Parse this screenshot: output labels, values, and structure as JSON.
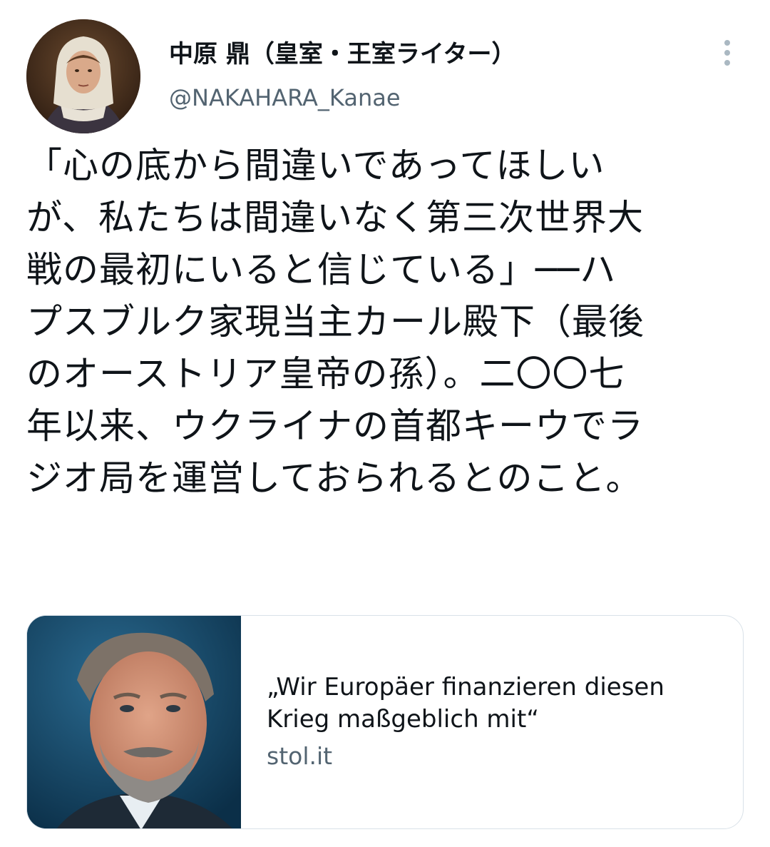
{
  "author": {
    "display_name": "中原 鼎（皇室・王室ライター）",
    "handle": "@NAKAHARA_Kanae",
    "avatar_icon": "portrait-avatar"
  },
  "more_icon": "more-vertical-icon",
  "tweet": {
    "lines": [
      "「心の底から間違いであってほしい",
      "が、私たちは間違いなく第三次世界大",
      "戦の最初にいると信じている」──ハ",
      "プスブルク家現当主カール殿下（最後",
      "のオーストリア皇帝の孫）。二〇〇七",
      "年以来、ウクライナの首都キーウでラ",
      "ジオ局を運営しておられるとのこと。"
    ]
  },
  "card": {
    "title_lines": [
      "„Wir Europäer finanzieren diesen",
      "Krieg maßgeblich mit“"
    ],
    "domain": "stol.it",
    "image_icon": "article-thumbnail"
  },
  "colors": {
    "text": "#0f1419",
    "secondary": "#536471",
    "border": "#d9e1e8",
    "card_bg": "#0f3d5e"
  }
}
